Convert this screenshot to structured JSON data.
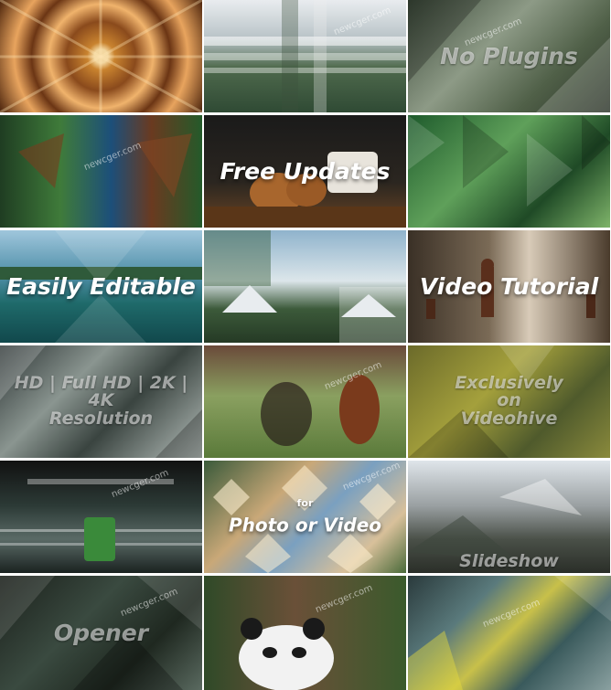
{
  "watermark": "newcger.com",
  "tiles": [
    {
      "label": ""
    },
    {
      "label": ""
    },
    {
      "label": "No Plugins"
    },
    {
      "label": ""
    },
    {
      "label": "Free Updates"
    },
    {
      "label": ""
    },
    {
      "label": "Easily Editable"
    },
    {
      "label": "Video Tutorial"
    },
    {
      "label": "HD | Full HD | 2K | 4K\nResolution"
    },
    {
      "label": ""
    },
    {
      "label": "Exclusively\non\nVideohive"
    },
    {
      "label": "Photo or Video"
    },
    {
      "label": "for"
    },
    {
      "label": "Slideshow"
    },
    {
      "label": "Opener"
    },
    {
      "label": ""
    }
  ]
}
